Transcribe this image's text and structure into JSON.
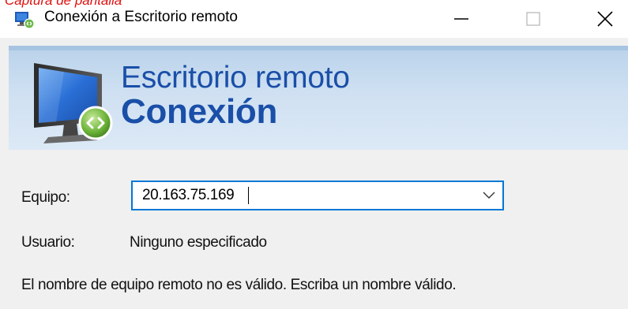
{
  "annotation": {
    "clipped_text": "Captura de pantalla"
  },
  "window": {
    "title": "Conexión a Escritorio remoto",
    "icon": "remote-desktop-icon",
    "controls": {
      "minimize_icon": "minimize-icon",
      "maximize_icon": "maximize-icon",
      "close_icon": "close-icon"
    }
  },
  "banner": {
    "line1": "Escritorio remoto",
    "line2": "Conexión",
    "icon": "remote-desktop-monitor-icon",
    "text_color": "#1a4fa8"
  },
  "form": {
    "computer": {
      "label": "Equipo:",
      "value": "20.163.75.169"
    },
    "user": {
      "label": "Usuario:",
      "value": "Ninguno especificado"
    },
    "error_message": "El nombre de equipo remoto no es válido. Escriba un nombre válido."
  },
  "colors": {
    "focus_border": "#0078d7",
    "background": "#f0f0f0"
  }
}
